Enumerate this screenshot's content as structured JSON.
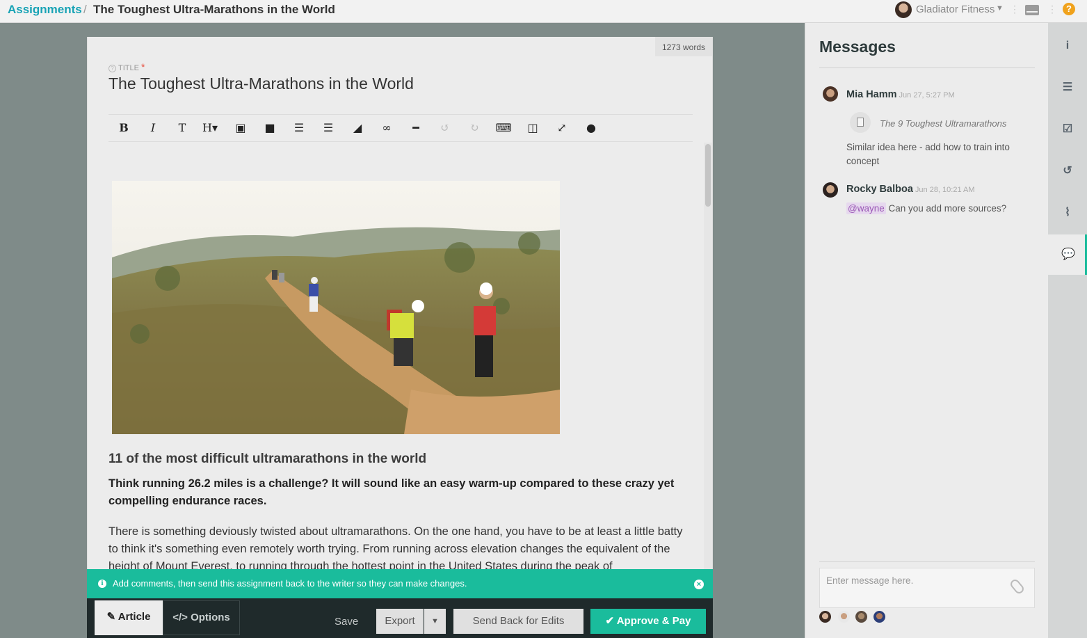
{
  "topbar": {
    "breadcrumb_root": "Assignments",
    "breadcrumb_sep": "/",
    "breadcrumb_current": "The Toughest Ultra-Marathons in the World",
    "account_name": "Gladiator Fitness",
    "help_glyph": "?"
  },
  "editor": {
    "word_count": "1273 words",
    "title_label": "TITLE",
    "title_required": "*",
    "title_value": "The Toughest Ultra-Marathons in the World",
    "toolbar": [
      {
        "name": "bold-icon",
        "glyph": "B"
      },
      {
        "name": "italic-icon",
        "glyph": "I"
      },
      {
        "name": "clear-format-icon",
        "glyph": "T"
      },
      {
        "name": "heading-icon",
        "glyph": "H▾"
      },
      {
        "name": "image-icon",
        "glyph": "▣"
      },
      {
        "name": "video-icon",
        "glyph": "■"
      },
      {
        "name": "ordered-list-icon",
        "glyph": "☰"
      },
      {
        "name": "unordered-list-icon",
        "glyph": "☰"
      },
      {
        "name": "eraser-icon",
        "glyph": "◢"
      },
      {
        "name": "link-icon",
        "glyph": "∞"
      },
      {
        "name": "horizontal-rule-icon",
        "glyph": "━"
      },
      {
        "name": "undo-icon",
        "glyph": "↺"
      },
      {
        "name": "redo-icon",
        "glyph": "↻"
      },
      {
        "name": "keyboard-icon",
        "glyph": "⌨"
      },
      {
        "name": "columns-icon",
        "glyph": "◫"
      },
      {
        "name": "fullscreen-icon",
        "glyph": "⤢"
      },
      {
        "name": "comment-icon",
        "glyph": "●"
      }
    ],
    "heading": "11 of the most difficult ultramarathons in the world",
    "lead": "Think running 26.2 miles is a challenge? It will sound like an easy warm-up compared to these crazy yet compelling endurance races.",
    "body": "There is something deviously twisted about ultramarathons. On the one hand, you have to be at least a little batty to think it's something even remotely worth trying. From running across elevation changes the equivalent of the height of Mount Everest, to running through the hottest point in the United States during the peak of"
  },
  "notice": {
    "text": "Add comments, then send this assignment back to the writer so they can make changes.",
    "info_glyph": "i",
    "close_glyph": "×"
  },
  "bottombar": {
    "tab_article": "✎ Article",
    "tab_options": "</> Options",
    "save": "Save",
    "export": "Export",
    "export_caret": "▼",
    "send_back": "Send Back for Edits",
    "approve": "✔ Approve & Pay"
  },
  "messages": {
    "heading": "Messages",
    "items": [
      {
        "author": "Mia Hamm",
        "time": "Jun 27, 5:27 PM",
        "attachment": "The 9 Toughest Ultramarathons",
        "text": "Similar idea here - add how to train into concept"
      },
      {
        "author": "Rocky Balboa",
        "time": "Jun 28, 10:21 AM",
        "mention": "@wayne",
        "text": "Can you add more sources?"
      }
    ],
    "input_placeholder": "Enter message here."
  },
  "rail": [
    {
      "name": "info-icon",
      "glyph": "i",
      "active": false
    },
    {
      "name": "list-icon",
      "glyph": "☰",
      "active": false
    },
    {
      "name": "checkbox-icon",
      "glyph": "☑",
      "active": false
    },
    {
      "name": "history-icon",
      "glyph": "↺",
      "active": false
    },
    {
      "name": "paperclip-icon",
      "glyph": "⌇",
      "active": false
    },
    {
      "name": "chat-icon",
      "glyph": "💬",
      "active": true
    }
  ]
}
